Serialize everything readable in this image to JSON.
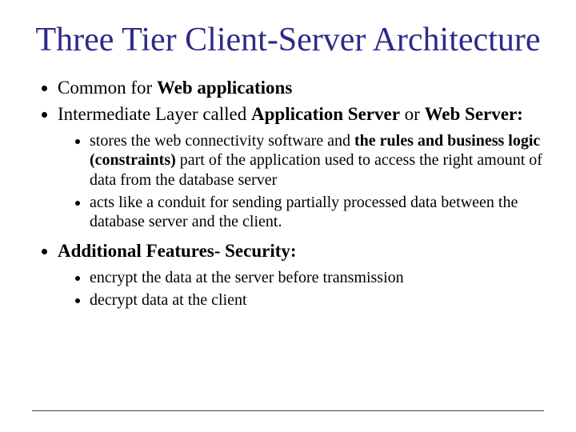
{
  "title": "Three Tier Client-Server Architecture",
  "bullets": {
    "b1_pre": "Common for ",
    "b1_bold": "Web applications",
    "b2_pre": "Intermediate Layer called ",
    "b2_bold1": "Application Server",
    "b2_mid": " or ",
    "b2_bold2": "Web Server:",
    "b2_sub1_pre": "stores the web connectivity software and ",
    "b2_sub1_bold": "the rules and business logic (constraints)",
    "b2_sub1_post": " part of the application used to access the right amount of data from the database server",
    "b2_sub2": "acts like a conduit for sending partially processed data between the database server and the client.",
    "b3_bold": "Additional Features- Security:",
    "b3_sub1": "encrypt the data at the server before transmission",
    "b3_sub2": "decrypt data at the client"
  }
}
